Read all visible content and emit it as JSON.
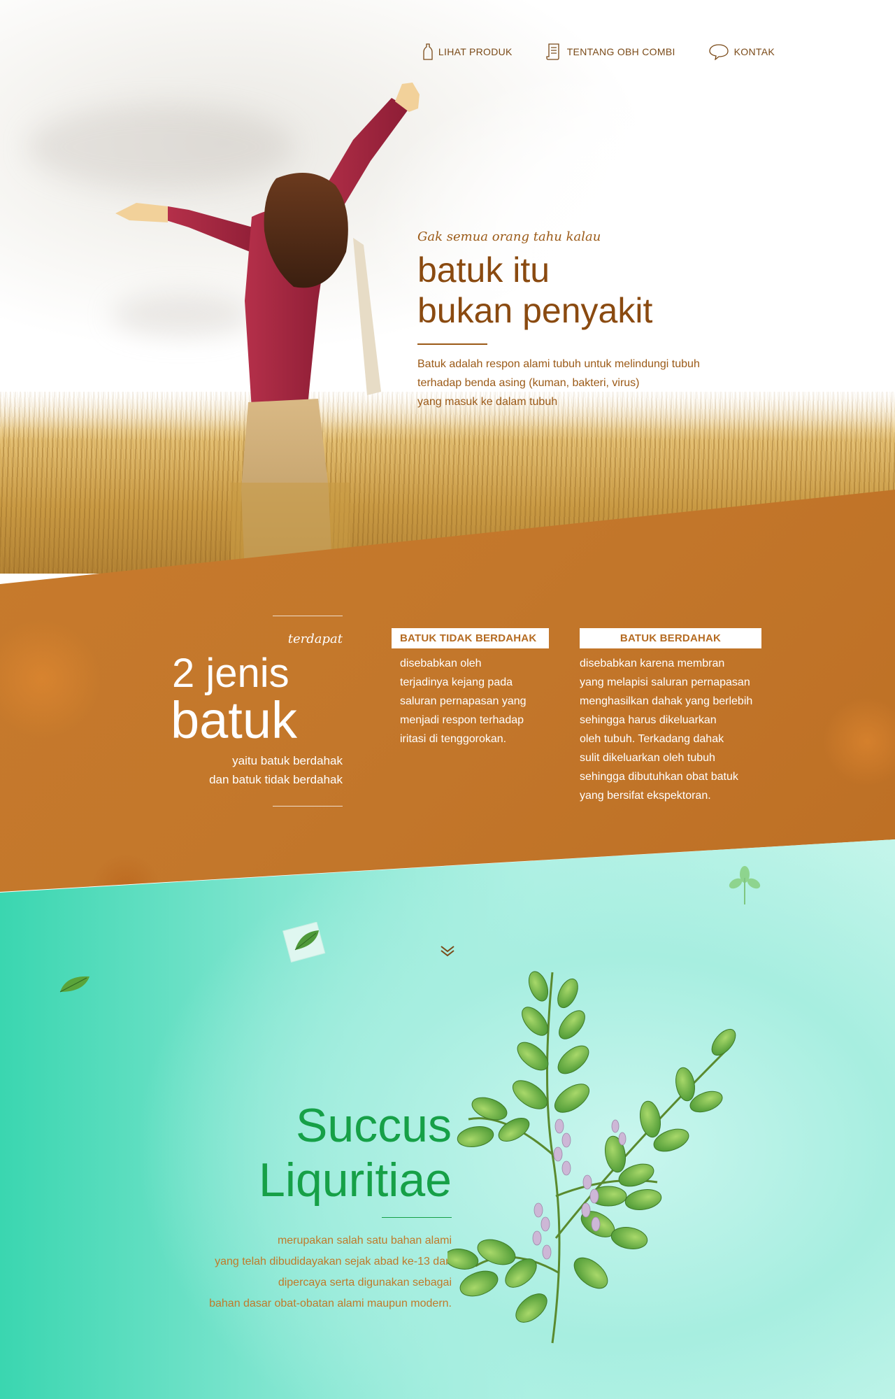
{
  "nav": {
    "items": [
      {
        "label": "LIHAT PRODUK",
        "icon": "bottle-icon"
      },
      {
        "label": "TENTANG OBH COMBI",
        "icon": "document-icon"
      },
      {
        "label": "KONTAK",
        "icon": "speech-bubble-icon"
      }
    ]
  },
  "hero": {
    "kicker": "Gak semua orang tahu kalau",
    "title_line1": "batuk itu",
    "title_line2": "bukan penyakit",
    "desc_line1": "Batuk adalah respon alami tubuh untuk melindungi tubuh",
    "desc_line2": "terhadap benda asing (kuman, bakteri, virus)",
    "desc_line3": "yang masuk ke dalam tubuh"
  },
  "types": {
    "kicker": "terdapat",
    "title_line1": "2 jenis",
    "title_line2": "batuk",
    "sub_line1": "yaitu batuk berdahak",
    "sub_line2": "dan batuk tidak berdahak",
    "items": [
      {
        "label": "BATUK TIDAK BERDAHAK",
        "lines": [
          "disebabkan oleh",
          "terjadinya kejang pada",
          "saluran pernapasan yang",
          "menjadi respon terhadap",
          "iritasi di tenggorokan."
        ]
      },
      {
        "label": "BATUK BERDAHAK",
        "lines": [
          "disebabkan karena membran",
          "yang melapisi saluran pernapasan",
          "menghasilkan dahak yang berlebih",
          "sehingga harus dikeluarkan",
          "oleh tubuh. Terkadang dahak",
          "sulit dikeluarkan oleh tubuh",
          "sehingga dibutuhkan obat batuk",
          "yang bersifat ekspektoran."
        ]
      }
    ]
  },
  "ingredient": {
    "title_line1": "Succus",
    "title_line2": "Liquritiae",
    "lines": [
      "merupakan salah satu bahan alami",
      "yang telah dibudidayakan sejak abad ke-13 dan",
      "dipercaya serta digunakan sebagai",
      "bahan dasar obat-obatan alami maupun modern."
    ]
  },
  "colors": {
    "brown_text": "#8a4a10",
    "band": "#c3772b",
    "teal": "#a7eee0",
    "green_title": "#16a047"
  }
}
